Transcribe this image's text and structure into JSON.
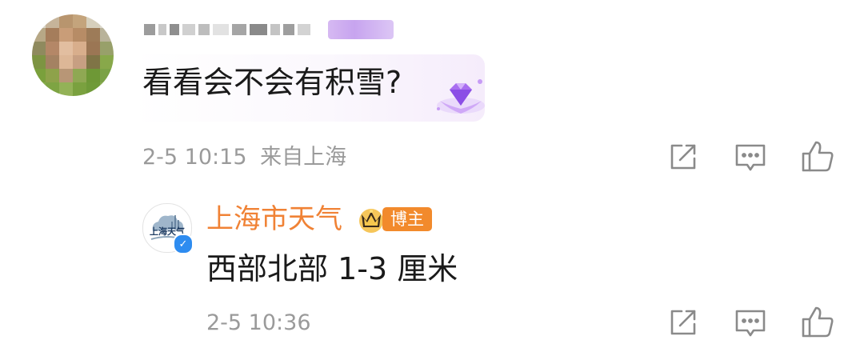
{
  "comment": {
    "text": "看看会不会有积雪?",
    "date": "2-5 10:15",
    "location": "来自上海"
  },
  "reply": {
    "author": "上海市天气",
    "author_badge": "博主",
    "avatar_text": "上海天气",
    "text": "西部北部 1-3 厘米",
    "date": "2-5 10:36"
  },
  "colors": {
    "author_name": "#f08235",
    "host_badge": "#f28a2c",
    "meta_text": "#9a9a9a",
    "verified": "#2e8cf0"
  },
  "icons": {
    "repost": "share-square-icon",
    "comment": "comment-icon",
    "like": "thumbs-up-icon"
  }
}
